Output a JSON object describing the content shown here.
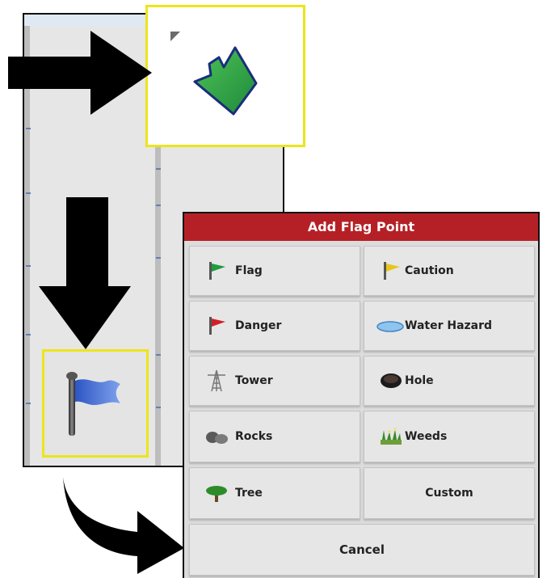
{
  "dialog": {
    "title": "Add Flag Point",
    "buttons": [
      {
        "label": "Flag",
        "icon": "green-flag-icon"
      },
      {
        "label": "Caution",
        "icon": "yellow-flag-icon"
      },
      {
        "label": "Danger",
        "icon": "red-flag-icon"
      },
      {
        "label": "Water Hazard",
        "icon": "water-puddle-icon"
      },
      {
        "label": "Tower",
        "icon": "tower-icon"
      },
      {
        "label": "Hole",
        "icon": "hole-icon"
      },
      {
        "label": "Rocks",
        "icon": "rocks-icon"
      },
      {
        "label": "Weeds",
        "icon": "weeds-icon"
      },
      {
        "label": "Tree",
        "icon": "tree-icon"
      },
      {
        "label": "Custom",
        "icon": ""
      }
    ],
    "cancel_label": "Cancel"
  },
  "colors": {
    "title_bar": "#b52026",
    "highlight": "#ece51a",
    "field": "#2ea84a",
    "flag": "#3b6fd8"
  }
}
